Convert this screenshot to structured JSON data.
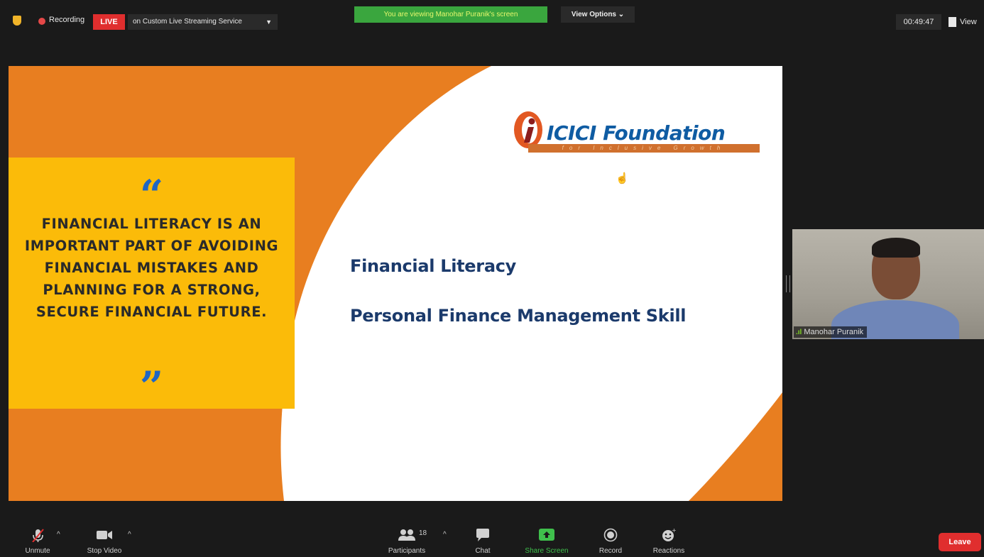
{
  "top_bar": {
    "recording_label": "Recording",
    "live_label": "LIVE",
    "stream_service": "on Custom Live Streaming Service",
    "viewing_banner": "You are viewing Manohar Puranik's screen",
    "view_options": "View Options",
    "timer": "00:49:47",
    "view_label": "View"
  },
  "slide": {
    "quote_open": "“",
    "quote_close": "”",
    "quote_text": "FINANCIAL LITERACY IS AN IMPORTANT PART OF AVOIDING FINANCIAL MISTAKES AND PLANNING FOR A STRONG, SECURE FINANCIAL FUTURE.",
    "logo_name": "ICICI Foundation",
    "logo_tagline": "for Inclusive Growth",
    "heading1": "Financial Literacy",
    "heading2": "Personal Finance Management Skill"
  },
  "participant": {
    "name": "Manohar Puranik"
  },
  "toolbar": {
    "unmute": "Unmute",
    "stop_video": "Stop Video",
    "participants": "Participants",
    "participants_count": "18",
    "chat": "Chat",
    "share_screen": "Share Screen",
    "record": "Record",
    "reactions": "Reactions",
    "leave": "Leave"
  },
  "colors": {
    "live_red": "#e02e2e",
    "banner_green": "#3aa63e",
    "slide_orange": "#e87e20",
    "quote_yellow": "#fbbb09",
    "heading_navy": "#1b3a6b",
    "logo_blue": "#0f5ca3"
  },
  "icons": [
    "shield-icon",
    "record-dot-icon",
    "caret-down-icon",
    "grid-view-icon",
    "mic-muted-icon",
    "video-camera-icon",
    "participants-icon",
    "chat-bubble-icon",
    "share-screen-icon",
    "record-icon",
    "reactions-icon",
    "pointer-cursor-icon",
    "signal-bars-icon"
  ]
}
